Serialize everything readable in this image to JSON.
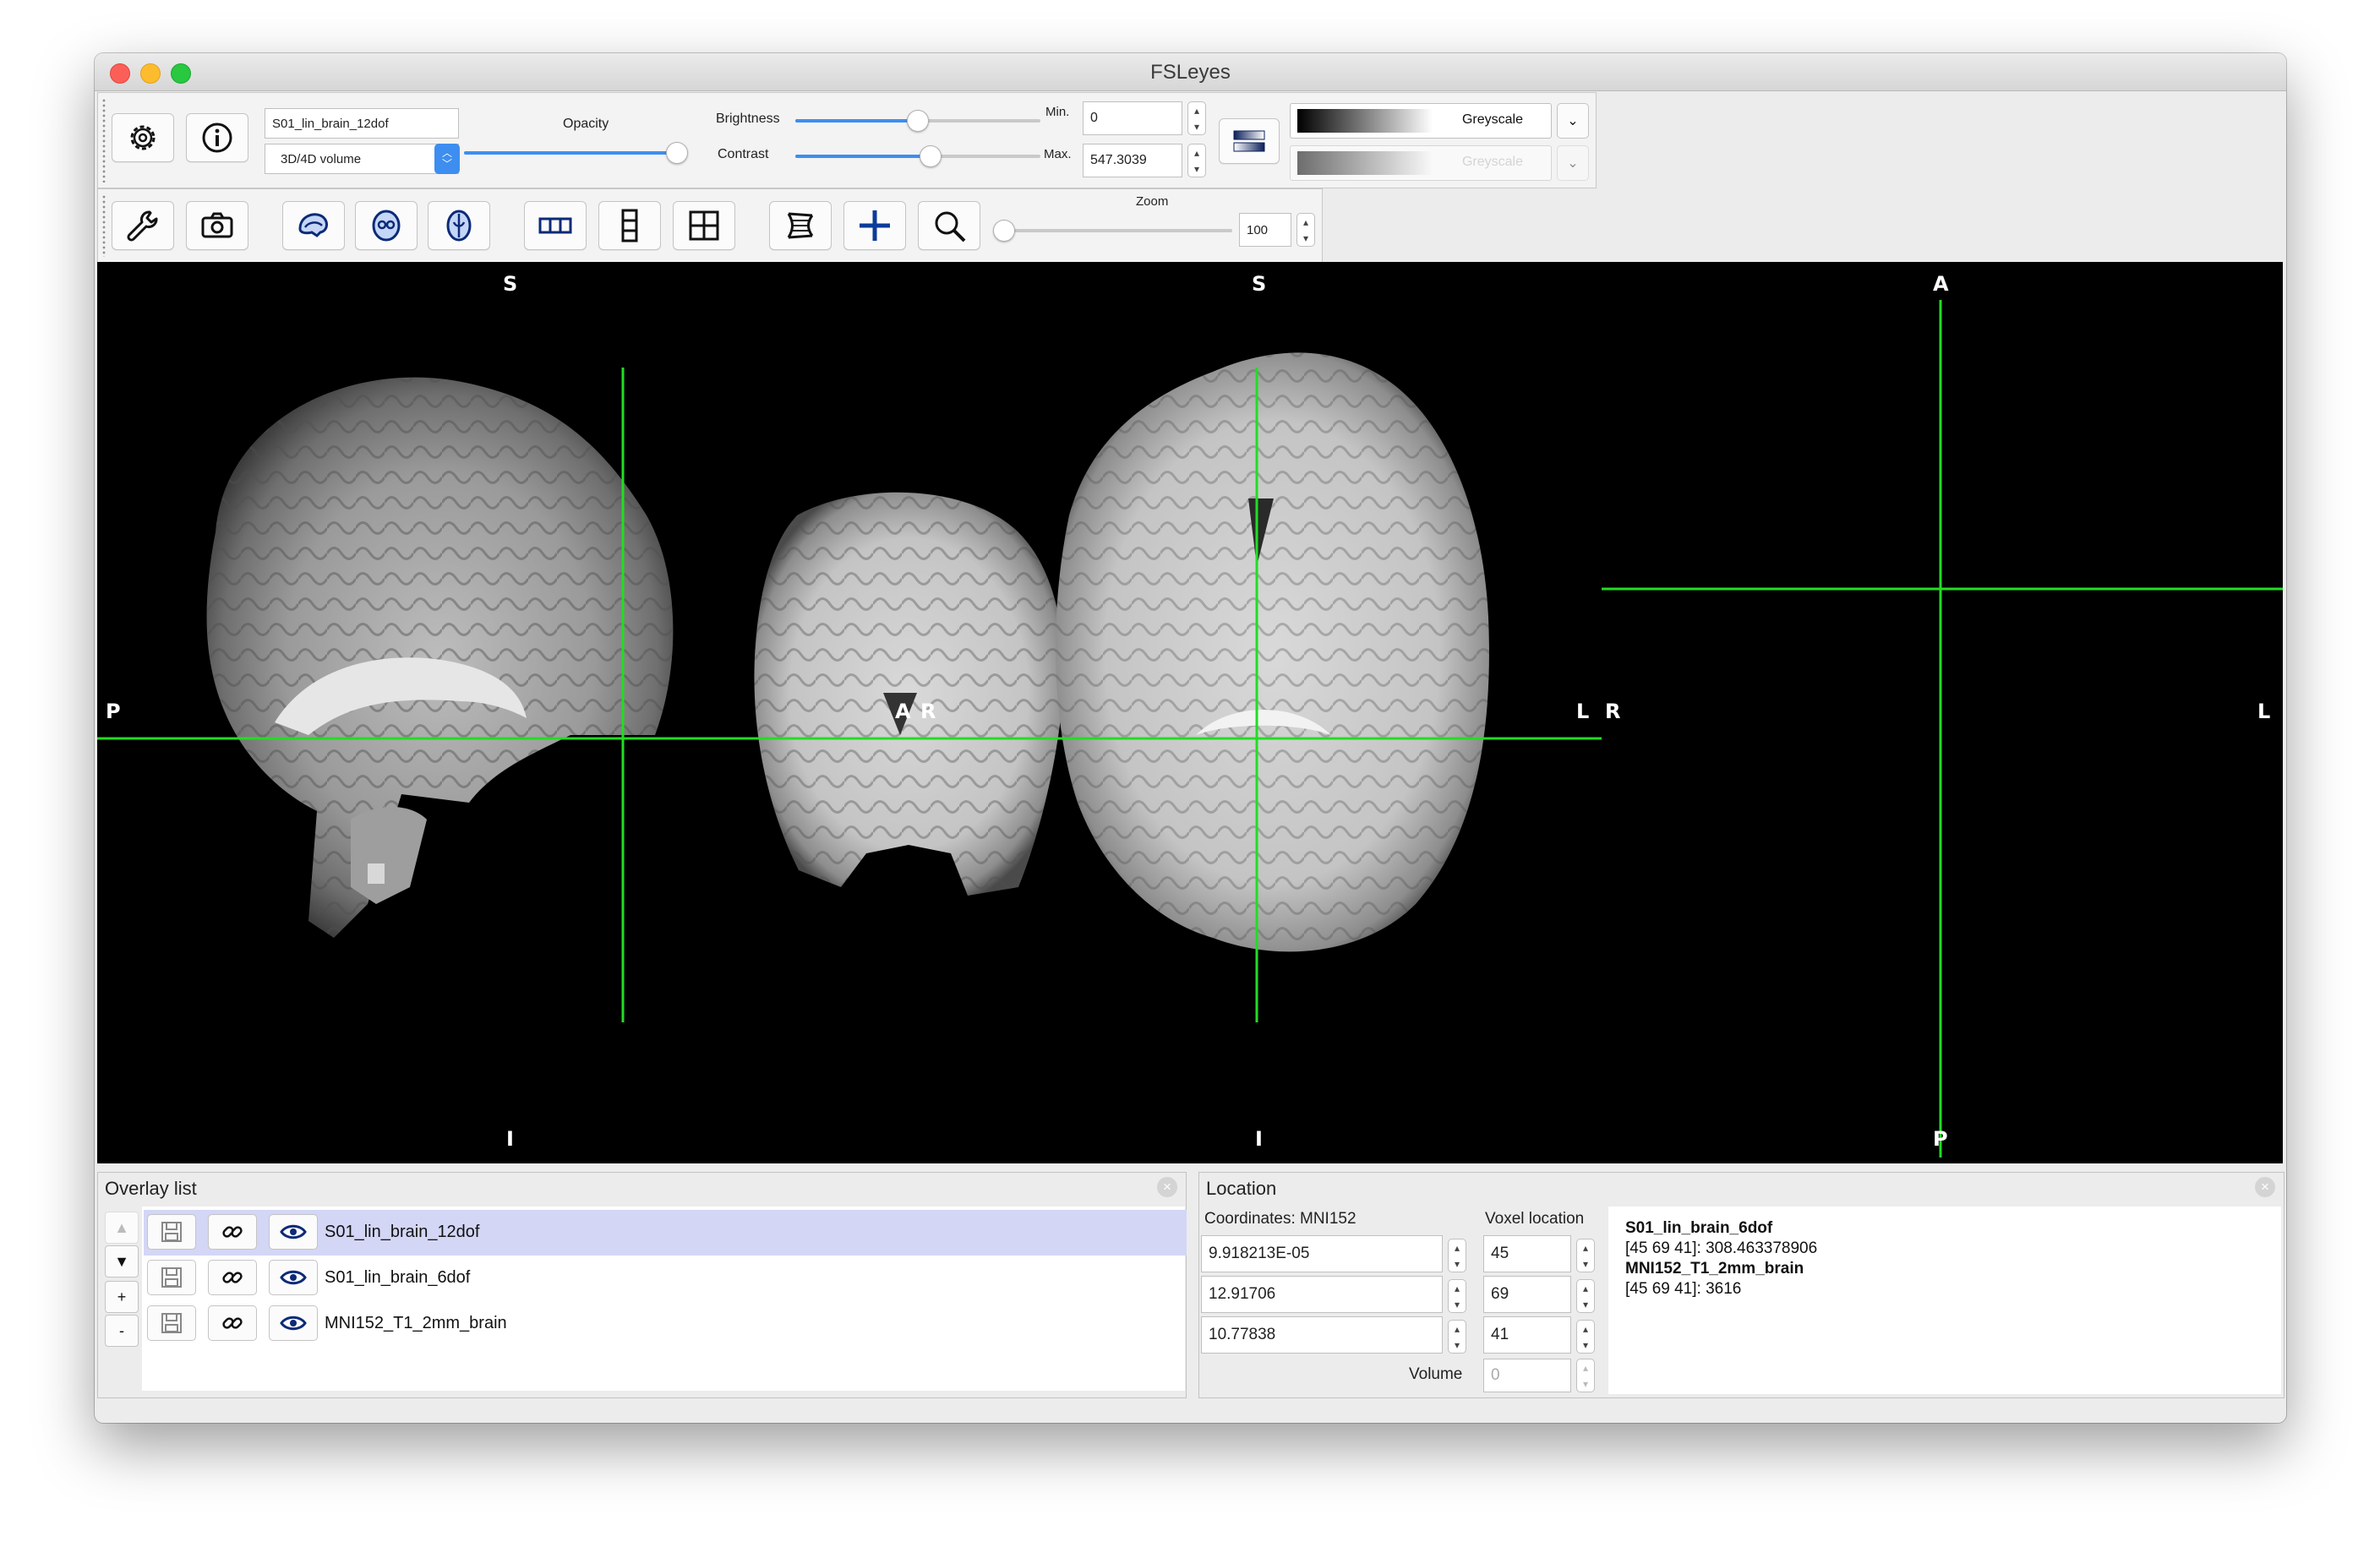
{
  "window": {
    "title": "FSLeyes"
  },
  "toolbar": {
    "overlay_name": "S01_lin_brain_12dof",
    "overlay_type": "3D/4D volume",
    "opacity_label": "Opacity",
    "opacity": 0.97,
    "brightness_label": "Brightness",
    "brightness": 0.5,
    "contrast_label": "Contrast",
    "contrast": 0.55,
    "min_label": "Min.",
    "min_value": "0",
    "max_label": "Max.",
    "max_value": "547.3039",
    "colormap_primary": "Greyscale",
    "colormap_secondary": "Greyscale",
    "zoom_label": "Zoom",
    "zoom_value": "100",
    "zoom": 0.0
  },
  "icons": [
    "gear-icon",
    "info-icon",
    "wrench-icon",
    "camera-icon",
    "sagittal-toggle-icon",
    "coronal-toggle-icon",
    "axial-toggle-icon",
    "horizontal-layout-icon",
    "vertical-layout-icon",
    "grid-layout-icon",
    "movie-icon",
    "cursor-toggle-icon",
    "zoom-icon",
    "colormap-invert-icon"
  ],
  "views": {
    "sagittal": {
      "top": "S",
      "bottom": "I",
      "left": "P",
      "right": "A"
    },
    "coronal": {
      "top": "S",
      "bottom": "I",
      "left": "R",
      "right": "L"
    },
    "axial": {
      "top": "A",
      "bottom": "P",
      "left": "R",
      "right": "L"
    }
  },
  "cursor_color": "#22dd22",
  "overlay_list": {
    "title": "Overlay list",
    "items": [
      {
        "name": "S01_lin_brain_12dof",
        "selected": true
      },
      {
        "name": "S01_lin_brain_6dof",
        "selected": false
      },
      {
        "name": "MNI152_T1_2mm_brain",
        "selected": false
      }
    ],
    "side_buttons": [
      "▲",
      "▼",
      "+",
      "-"
    ]
  },
  "location": {
    "title": "Location",
    "coords_label": "Coordinates: MNI152",
    "voxel_label": "Voxel location",
    "coords": [
      "9.918213E-05",
      "12.91706",
      "10.77838"
    ],
    "voxels": [
      "45",
      "69",
      "41"
    ],
    "volume_label": "Volume",
    "volume_value": "0",
    "info": [
      {
        "name": "S01_lin_brain_6dof",
        "value": "[45 69 41]: 308.463378906"
      },
      {
        "name": "MNI152_T1_2mm_brain",
        "value": "[45 69 41]: 3616"
      }
    ]
  }
}
